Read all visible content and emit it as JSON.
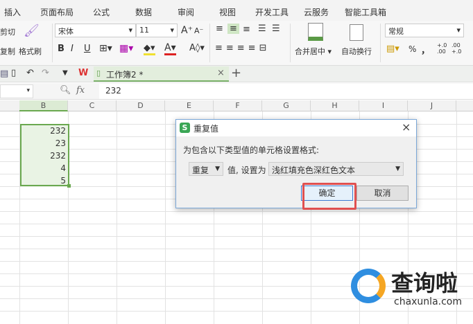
{
  "menu": [
    "插入",
    "页面布局",
    "公式",
    "数据",
    "审阅",
    "视图",
    "开发工具",
    "云服务",
    "智能工具箱"
  ],
  "ribbon": {
    "cut": "剪切",
    "copy": "复制",
    "format_painter": "格式刷",
    "font": "宋体",
    "size": "11",
    "bold": "B",
    "italic": "I",
    "underline": "U",
    "merge": "合并居中",
    "wrap": "自动换行",
    "number_format": "常规",
    "percent": "%",
    "comma": "，",
    "inc_dec": "+.0 .00",
    "dec_dec": ".00 +.0"
  },
  "tabbar": {
    "doc_tab": "工作簿2 *",
    "close": "×",
    "add": "+"
  },
  "formula_bar": {
    "fx": "fx",
    "value": "232"
  },
  "columns": [
    "B",
    "C",
    "D",
    "E",
    "F",
    "G",
    "H",
    "I",
    "J"
  ],
  "cells": [
    "232",
    "23",
    "232",
    "4",
    "5"
  ],
  "dialog": {
    "title": "重复值",
    "prompt": "为包含以下类型值的单元格设置格式:",
    "type_select": "重复",
    "mid_label": "值, 设置为",
    "format_select": "浅红填充色深红色文本",
    "ok": "确定",
    "cancel": "取消",
    "close": "×"
  },
  "watermark": {
    "brand": "查询啦",
    "url": "chaxunla.com"
  },
  "colors": {
    "accent": "#6aa84f",
    "highlight": "#e05050",
    "dialog_border": "#7aa7d8"
  }
}
